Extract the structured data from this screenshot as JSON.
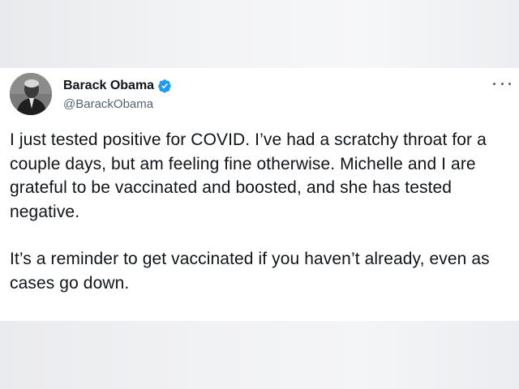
{
  "user": {
    "display_name": "Barack Obama",
    "handle": "@BarackObama",
    "verified_color": "#1d9bf0"
  },
  "tweet": {
    "paragraphs": [
      "I just tested positive for COVID. I’ve had a scratchy throat for a couple days, but am feeling fine otherwise. Michelle and I are grateful to be vaccinated and boosted, and she has tested negative.",
      "It’s a reminder to get vaccinated if you haven’t already, even as cases go down."
    ]
  },
  "icons": {
    "more": "more-options-icon",
    "verified": "verified-badge-icon"
  }
}
